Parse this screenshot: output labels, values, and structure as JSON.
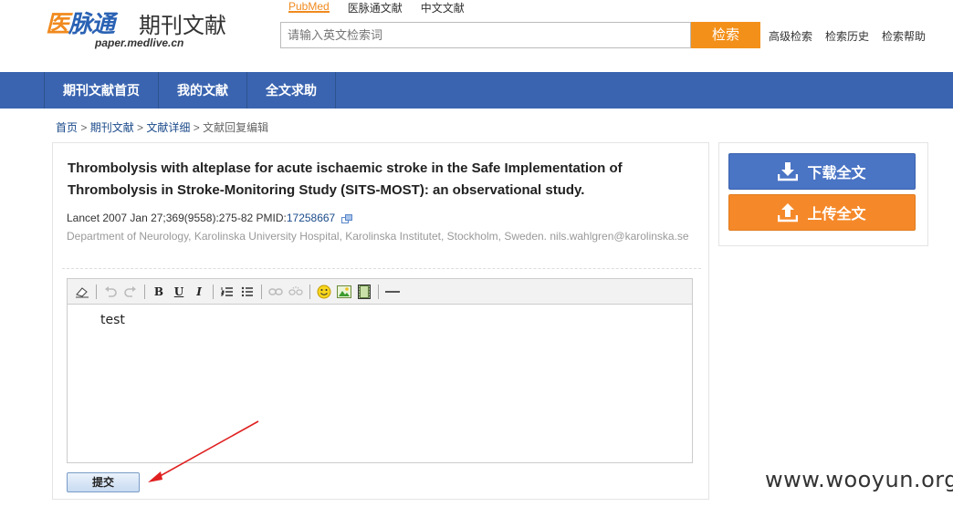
{
  "header": {
    "logo_brand_a": "医",
    "logo_brand_b": "脉通",
    "logo_title": "期刊文献",
    "logo_url": "paper.medlive.cn",
    "topnav": [
      "PubMed",
      "医脉通文献",
      "中文文献"
    ],
    "search_placeholder": "请输入英文检索词",
    "search_button": "检索",
    "links": [
      "高级检索",
      "检索历史",
      "检索帮助"
    ]
  },
  "navbar": [
    "期刊文献首页",
    "我的文献",
    "全文求助"
  ],
  "breadcrumb": {
    "items": [
      "首页",
      "期刊文献",
      "文献详细"
    ],
    "sep": " > ",
    "current": "文献回复编辑"
  },
  "article": {
    "title": "Thrombolysis with alteplase for acute ischaemic stroke in the Safe Implementation of Thrombolysis in Stroke-Monitoring Study (SITS-MOST): an observational study.",
    "citation": "Lancet 2007 Jan 27;369(9558):275-82 PMID:",
    "pmid": "17258667",
    "affiliation": "Department of Neurology, Karolinska University Hospital, Karolinska Institutet, Stockholm, Sweden. nils.wahlgren@karolinska.se"
  },
  "editor": {
    "content": "test",
    "toolbar": [
      "eraser-icon",
      "undo-icon",
      "redo-icon",
      "bold-icon",
      "underline-icon",
      "italic-icon",
      "ordered-list-icon",
      "unordered-list-icon",
      "link-icon",
      "unlink-icon",
      "emoticon-icon",
      "image-icon",
      "video-icon",
      "horizontal-rule-icon"
    ],
    "bold": "B",
    "underline": "U",
    "italic": "I"
  },
  "submit_button": "提交",
  "side": {
    "download": "下载全文",
    "upload": "上传全文"
  },
  "watermark": "www.wooyun.org",
  "colors": {
    "navbar": "#3a64b0",
    "accent": "#f39019",
    "download": "#4a74c4",
    "upload": "#f5892a"
  }
}
